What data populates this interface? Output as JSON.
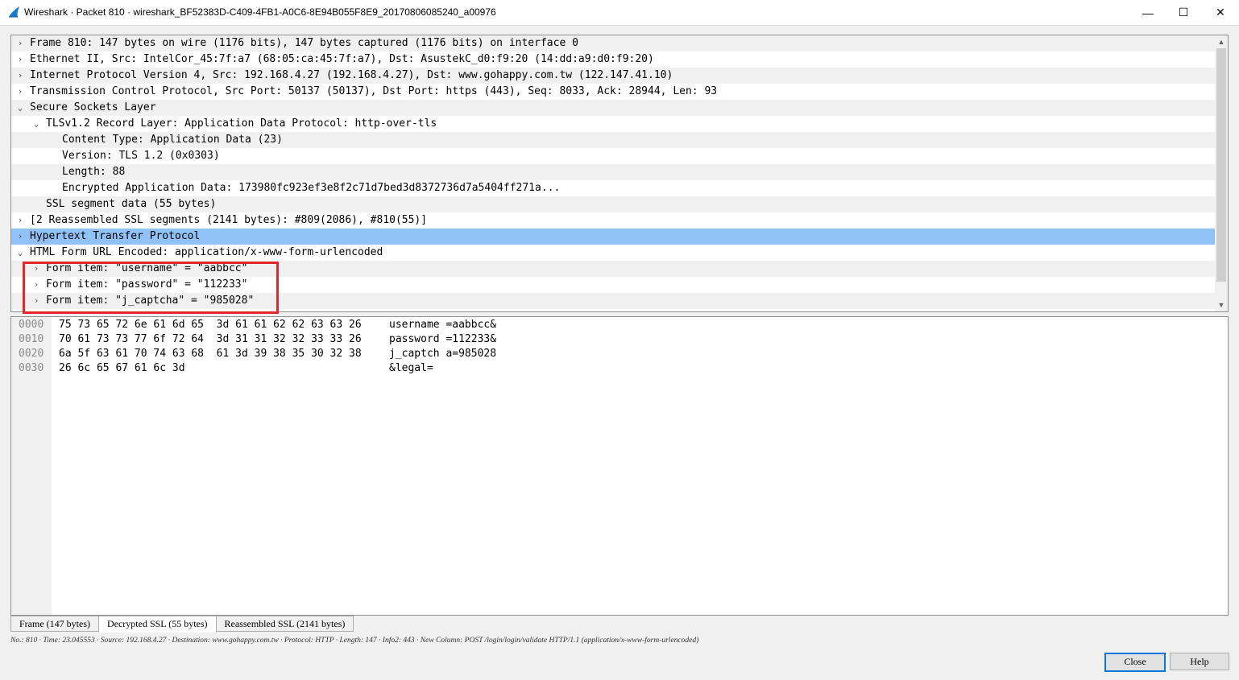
{
  "window": {
    "title": "Wireshark · Packet 810 · wireshark_BF52383D-C409-4FB1-A0C6-8E94B055F8E9_20170806085240_a00976",
    "minimize_glyph": "—",
    "maximize_glyph": "☐",
    "close_glyph": "✕",
    "app_icon": "wireshark-fin-icon",
    "accent": "#0078d7"
  },
  "tree": {
    "rows": [
      {
        "text": "Frame 810: 147 bytes on wire (1176 bits), 147 bytes captured (1176 bits) on interface 0",
        "arrow": "›",
        "indent": 0,
        "state": "collapsed"
      },
      {
        "text": "Ethernet II, Src: IntelCor_45:7f:a7 (68:05:ca:45:7f:a7), Dst: AsustekC_d0:f9:20 (14:dd:a9:d0:f9:20)",
        "arrow": "›",
        "indent": 0,
        "state": "collapsed"
      },
      {
        "text": "Internet Protocol Version 4, Src: 192.168.4.27 (192.168.4.27), Dst: www.gohappy.com.tw (122.147.41.10)",
        "arrow": "›",
        "indent": 0,
        "state": "collapsed"
      },
      {
        "text": "Transmission Control Protocol, Src Port: 50137 (50137), Dst Port: https (443), Seq: 8033, Ack: 28944, Len: 93",
        "arrow": "›",
        "indent": 0,
        "state": "collapsed"
      },
      {
        "text": "Secure Sockets Layer",
        "arrow": "⌄",
        "indent": 0,
        "state": "expanded"
      },
      {
        "text": "TLSv1.2 Record Layer: Application Data Protocol: http-over-tls",
        "arrow": "⌄",
        "indent": 1,
        "state": "expanded"
      },
      {
        "text": "Content Type: Application Data (23)",
        "arrow": "",
        "indent": 2,
        "state": "leaf"
      },
      {
        "text": "Version: TLS 1.2 (0x0303)",
        "arrow": "",
        "indent": 2,
        "state": "leaf"
      },
      {
        "text": "Length: 88",
        "arrow": "",
        "indent": 2,
        "state": "leaf"
      },
      {
        "text": "Encrypted Application Data: 173980fc923ef3e8f2c71d7bed3d8372736d7a5404ff271a...",
        "arrow": "",
        "indent": 2,
        "state": "leaf"
      },
      {
        "text": "SSL segment data (55 bytes)",
        "arrow": "",
        "indent": 1,
        "state": "leaf"
      },
      {
        "text": "[2 Reassembled SSL segments (2141 bytes): #809(2086), #810(55)]",
        "arrow": "›",
        "indent": 0,
        "state": "collapsed"
      },
      {
        "text": "Hypertext Transfer Protocol",
        "arrow": "›",
        "indent": 0,
        "state": "selected"
      },
      {
        "text": "HTML Form URL Encoded: application/x-www-form-urlencoded",
        "arrow": "⌄",
        "indent": 0,
        "state": "expanded"
      },
      {
        "text": "Form item: \"username\" = \"aabbcc\"",
        "arrow": "›",
        "indent": 1,
        "state": "collapsed"
      },
      {
        "text": "Form item: \"password\" = \"112233\"",
        "arrow": "›",
        "indent": 1,
        "state": "collapsed"
      },
      {
        "text": "Form item: \"j_captcha\" = \"985028\"",
        "arrow": "›",
        "indent": 1,
        "state": "collapsed"
      }
    ],
    "selected_color": "#91c2f7",
    "highlight_color": "#e3262a"
  },
  "hex": {
    "rows": [
      {
        "offset": "0000",
        "bytes": "75 73 65 72 6e 61 6d 65  3d 61 61 62 62 63 63 26",
        "ascii": "username =aabbcc&"
      },
      {
        "offset": "0010",
        "bytes": "70 61 73 73 77 6f 72 64  3d 31 31 32 32 33 33 26",
        "ascii": "password =112233&"
      },
      {
        "offset": "0020",
        "bytes": "6a 5f 63 61 70 74 63 68  61 3d 39 38 35 30 32 38",
        "ascii": "j_captch a=985028"
      },
      {
        "offset": "0030",
        "bytes": "26 6c 65 67 61 6c 3d",
        "ascii": "&legal="
      }
    ]
  },
  "tabs": [
    {
      "label": "Frame (147 bytes)",
      "active": false
    },
    {
      "label": "Decrypted SSL (55 bytes)",
      "active": true
    },
    {
      "label": "Reassembled SSL (2141 bytes)",
      "active": false
    }
  ],
  "status": "No.: 810 · Time: 23.045553 · Source: 192.168.4.27 · Destination: www.gohappy.com.tw · Protocol: HTTP · Length: 147 · Info2: 443 · New Column: POST /login/login/validate HTTP/1.1  (application/x-www-form-urlencoded)",
  "buttons": {
    "close": "Close",
    "help": "Help"
  }
}
